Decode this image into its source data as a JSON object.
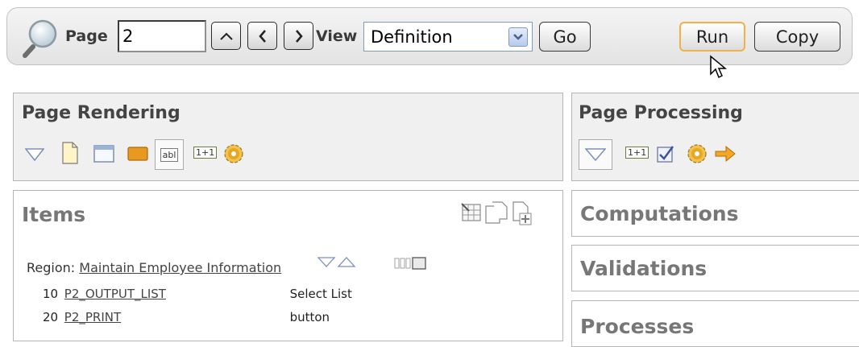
{
  "toolbar": {
    "page_label": "Page",
    "page_value": "2",
    "view_label": "View",
    "view_value": "Definition",
    "go_label": "Go",
    "run_label": "Run",
    "copy_label": "Copy"
  },
  "page_rendering": {
    "title": "Page Rendering",
    "icons": [
      "triangle-down-icon",
      "page-icon",
      "region-icon",
      "button-icon",
      "item-abl-icon",
      "computation-1plus1-icon",
      "gear-icon"
    ]
  },
  "page_processing": {
    "title": "Page Processing",
    "icons": [
      "triangle-down-icon",
      "computation-1plus1-icon",
      "validation-check-icon",
      "gear-icon",
      "branch-arrow-icon"
    ]
  },
  "items": {
    "title": "Items",
    "region_label": "Region:",
    "region_name": "Maintain Employee Information",
    "rows": [
      {
        "seq": "10",
        "name": "P2_OUTPUT_LIST",
        "type": "Select List"
      },
      {
        "seq": "20",
        "name": "P2_PRINT",
        "type": "button"
      }
    ]
  },
  "computations": {
    "title": "Computations"
  },
  "validations": {
    "title": "Validations"
  },
  "processes": {
    "title": "Processes"
  },
  "colors": {
    "button_highlight": "#f3b049",
    "region_icon": "#e79a1f",
    "arrow": "#f5a623"
  }
}
